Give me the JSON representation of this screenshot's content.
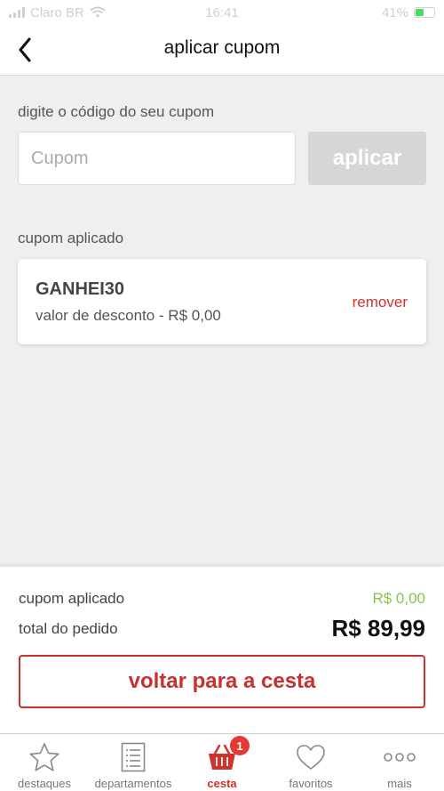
{
  "status_bar": {
    "carrier": "Claro BR",
    "time": "16:41",
    "battery": "41%"
  },
  "header": {
    "title": "aplicar cupom"
  },
  "coupon_form": {
    "label": "digite o código do seu cupom",
    "input_placeholder": "Cupom",
    "input_value": "",
    "apply_label": "aplicar"
  },
  "applied_coupon": {
    "section_label": "cupom aplicado",
    "code": "GANHEI30",
    "discount_text": "valor de desconto - R$ 0,00",
    "remove_label": "remover"
  },
  "summary": {
    "coupon_label": "cupom aplicado",
    "coupon_value": "R$ 0,00",
    "total_label": "total do pedido",
    "total_value": "R$ 89,99",
    "back_button_label": "voltar para a cesta"
  },
  "tabbar": {
    "items": [
      {
        "label": "destaques",
        "icon": "star-icon"
      },
      {
        "label": "departamentos",
        "icon": "list-icon"
      },
      {
        "label": "cesta",
        "icon": "basket-icon",
        "badge": "1",
        "active": true
      },
      {
        "label": "favoritos",
        "icon": "heart-icon"
      },
      {
        "label": "mais",
        "icon": "more-icon"
      }
    ]
  },
  "colors": {
    "accent": "#d0312d",
    "discount_green": "#8bc34a",
    "disabled_button": "#d6d6d6"
  }
}
